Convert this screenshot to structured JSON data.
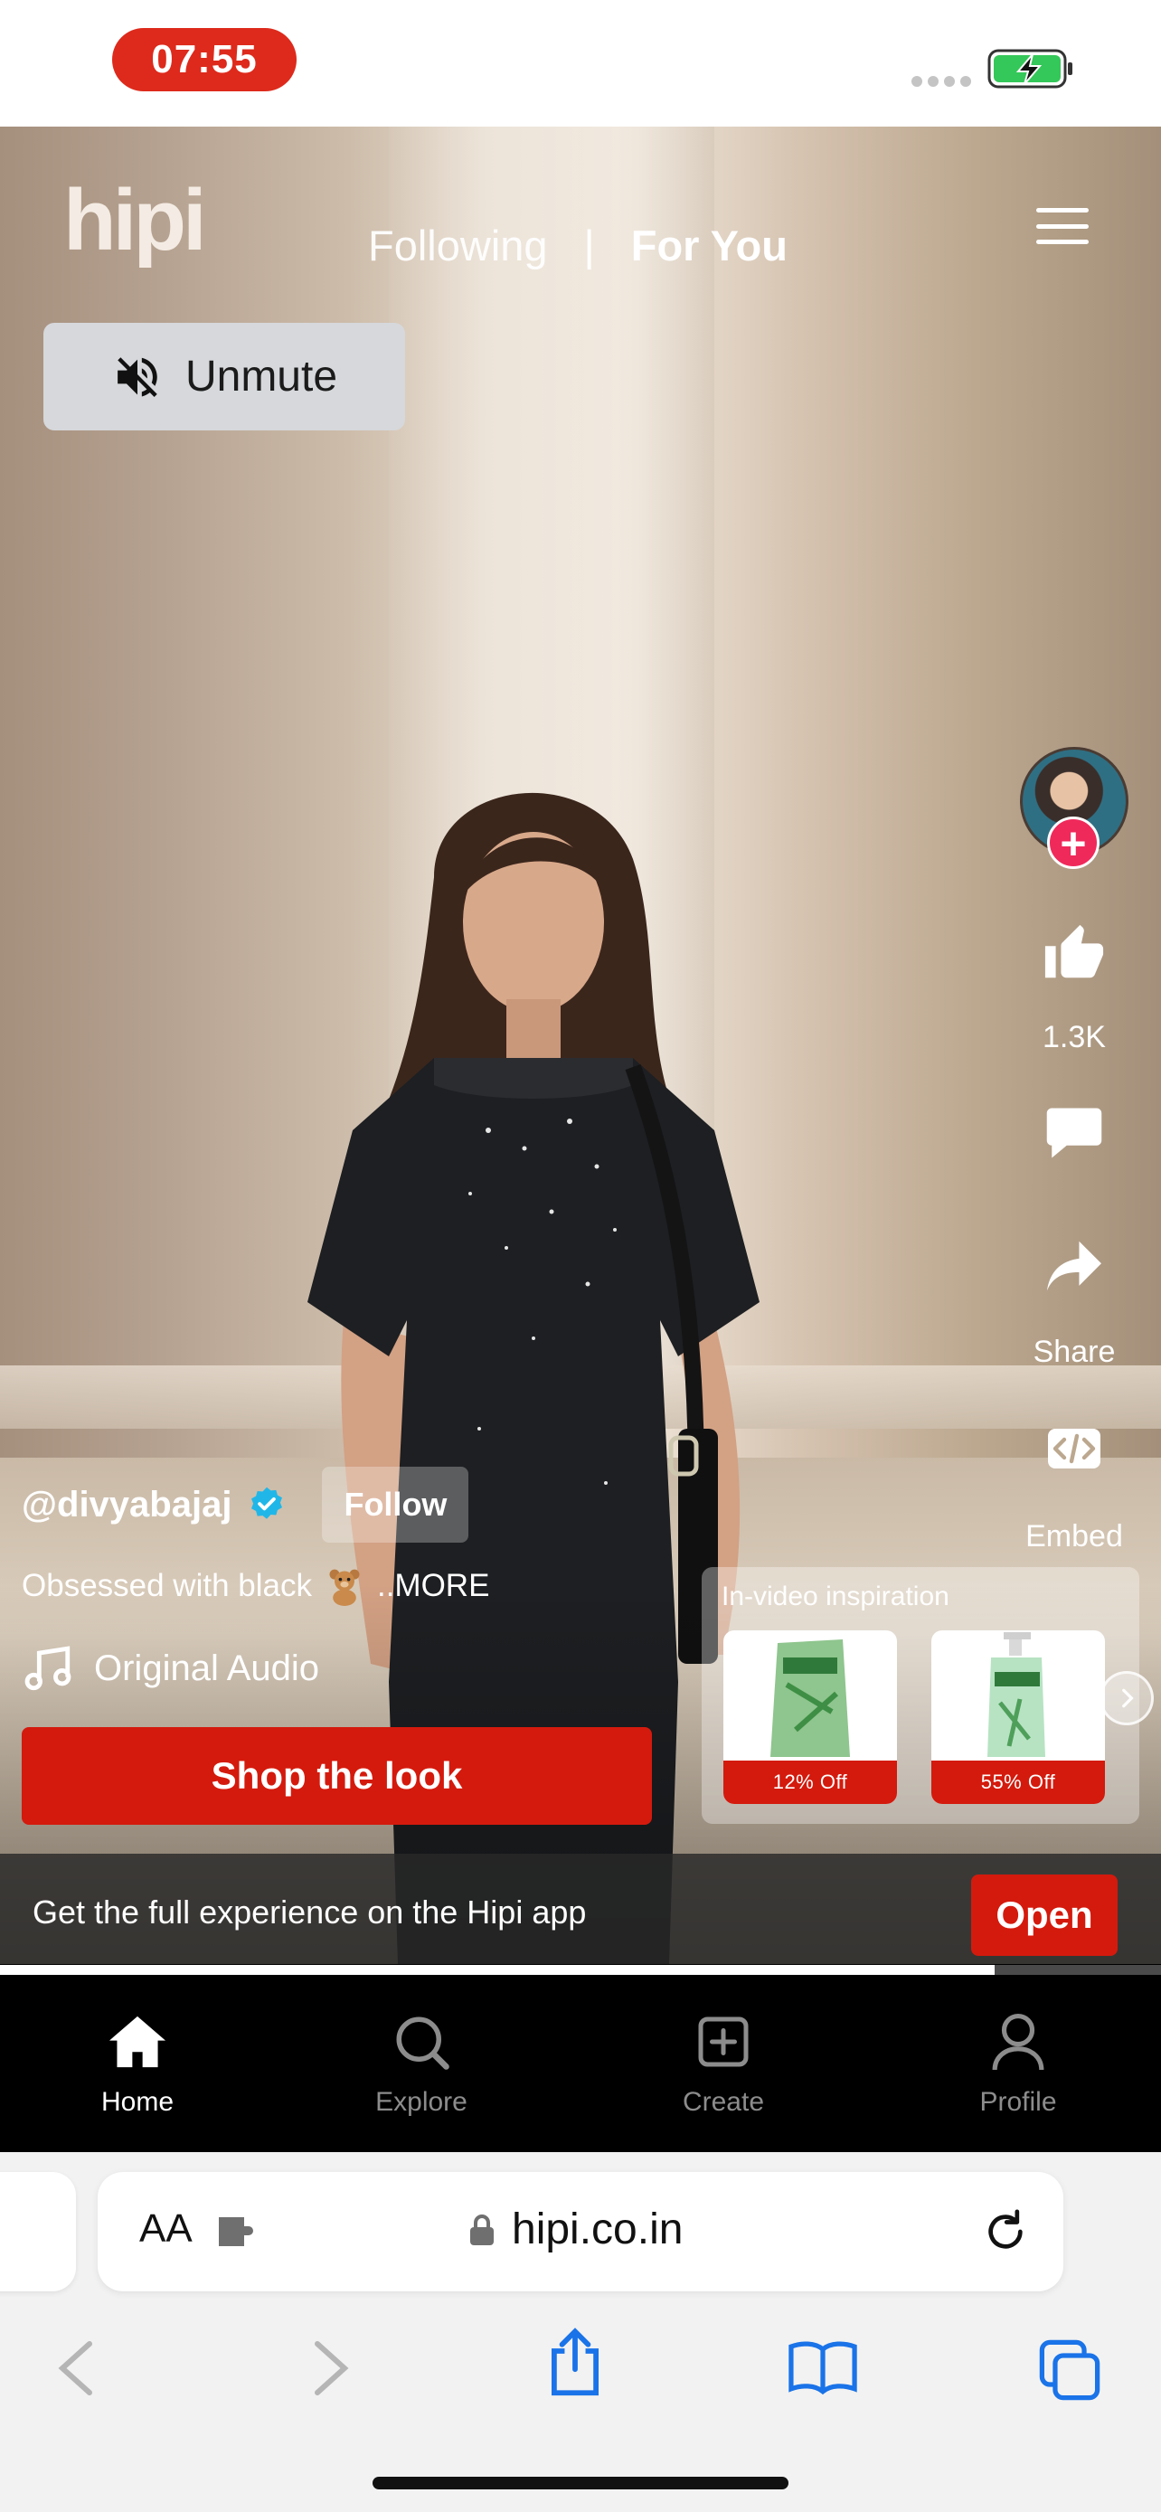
{
  "status_bar": {
    "time": "07:55"
  },
  "header": {
    "logo": "hipi",
    "tabs": [
      {
        "label": "Following",
        "active": false
      },
      {
        "label": "|"
      },
      {
        "label": "For You",
        "active": true
      }
    ]
  },
  "video": {
    "unmute_label": "Unmute",
    "creator": {
      "username": "@divyabajaj",
      "follow_label": "Follow"
    },
    "caption": "Obsessed with black",
    "caption_more": "..MORE",
    "audio": "Original Audio",
    "shop_label": "Shop the look",
    "progress_fraction": 0.857
  },
  "actions": {
    "likes": "1.3K",
    "share_label": "Share",
    "embed_label": "Embed"
  },
  "inspiration": {
    "title": "In-video inspiration",
    "products": [
      {
        "discount": "12% Off"
      },
      {
        "discount": "55% Off"
      }
    ]
  },
  "app_banner": {
    "text": "Get the full experience on the Hipi app",
    "open_label": "Open"
  },
  "bottom_nav": [
    {
      "label": "Home",
      "active": true
    },
    {
      "label": "Explore",
      "active": false
    },
    {
      "label": "Create",
      "active": false
    },
    {
      "label": "Profile",
      "active": false
    }
  ],
  "safari": {
    "aa_label": "AA",
    "url": "hipi.co.in"
  },
  "colors": {
    "brand_red": "#d41a0d",
    "status_red": "#dd2a1c",
    "follow_plus": "#f0295b",
    "ios_blue": "#1a73e8"
  }
}
